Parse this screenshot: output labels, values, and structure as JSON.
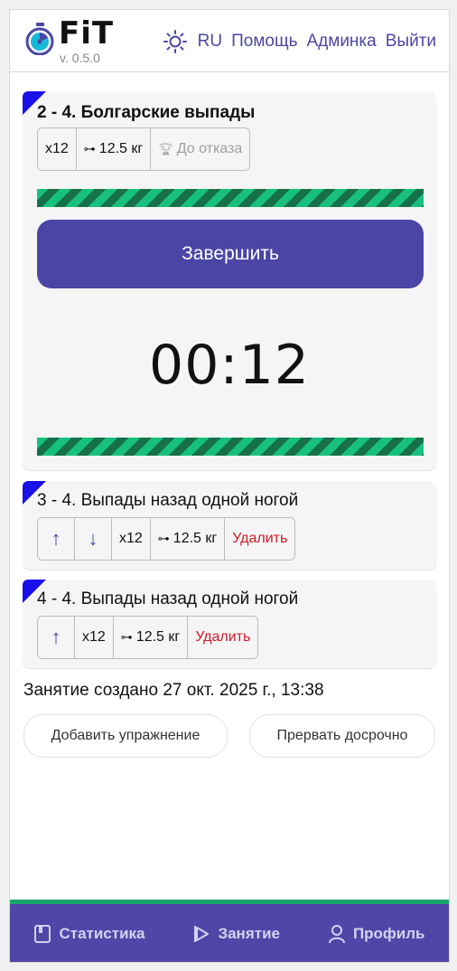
{
  "header": {
    "logo_text": "FiT",
    "version": "v. 0.5.0",
    "nav": [
      "RU",
      "Помощь",
      "Админка",
      "Выйти"
    ],
    "theme_icon": "sun-icon"
  },
  "active_exercise": {
    "title": "2 - 4. Болгарские выпады",
    "reps": "x12",
    "weight": "12.5 кг",
    "goal": "До отказа",
    "finish_label": "Завершить",
    "timer": "00:12"
  },
  "queue": [
    {
      "title": "3 - 4. Выпады назад одной ногой",
      "reps": "x12",
      "weight": "12.5 кг",
      "delete_label": "Удалить"
    },
    {
      "title": "4 - 4. Выпады назад одной ногой",
      "reps": "x12",
      "weight": "12.5 кг",
      "delete_label": "Удалить"
    }
  ],
  "session": {
    "created_text": "Занятие создано 27 окт. 2025 г., 13:38",
    "add_label": "Добавить упражнение",
    "abort_label": "Прервать досрочно"
  },
  "bottom_nav": [
    {
      "label": "Статистика",
      "icon": "book-icon"
    },
    {
      "label": "Занятие",
      "icon": "play-icon"
    },
    {
      "label": "Профиль",
      "icon": "user-icon"
    }
  ],
  "colors": {
    "accent": "#4b45a6",
    "stripe_light": "#18c07e",
    "stripe_dark": "#16704a",
    "corner": "#1a10ea",
    "danger": "#d11a2a"
  }
}
